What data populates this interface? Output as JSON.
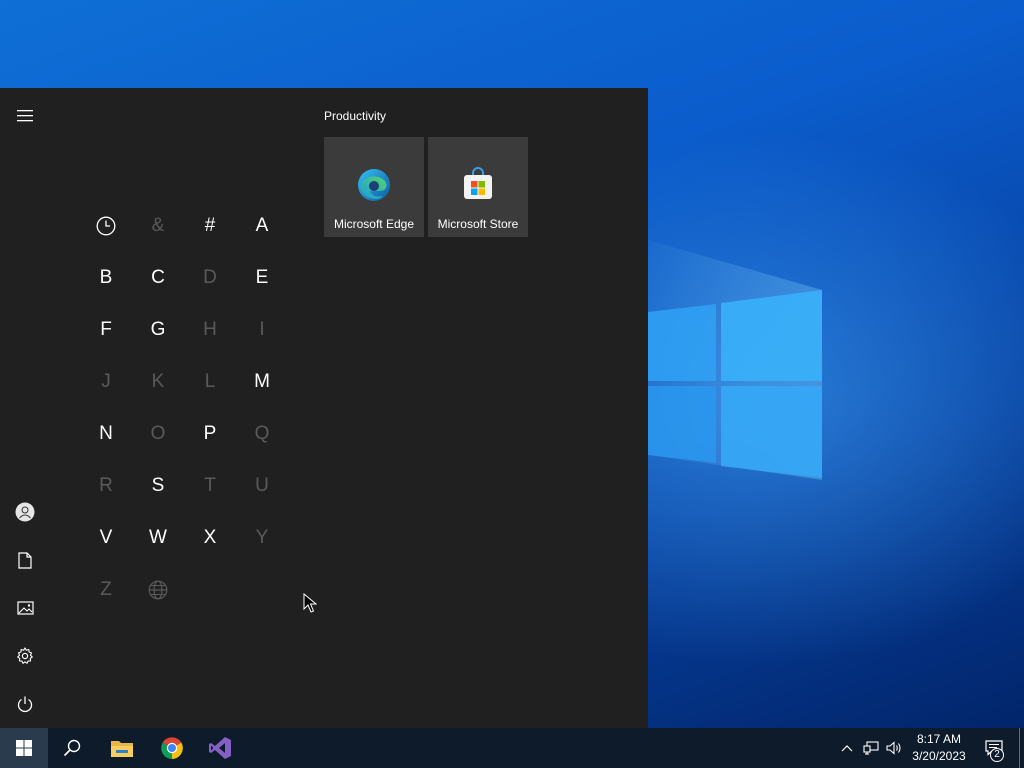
{
  "colors": {
    "start_menu_bg": "#202020",
    "tile_bg": "#3b3b3b",
    "taskbar_bg": "#0d1b2a",
    "disabled_letter": "#5a5a5a",
    "accent": "#0078d7"
  },
  "start_menu": {
    "rail": [
      {
        "name": "hamburger-menu",
        "icon": "hamburger-icon"
      },
      {
        "name": "user-account",
        "icon": "user-icon"
      },
      {
        "name": "documents",
        "icon": "document-icon"
      },
      {
        "name": "pictures",
        "icon": "pictures-icon"
      },
      {
        "name": "settings",
        "icon": "gear-icon"
      },
      {
        "name": "power",
        "icon": "power-icon"
      }
    ],
    "letters": [
      {
        "label": "",
        "icon": "clock-icon",
        "enabled": true
      },
      {
        "label": "&",
        "enabled": false
      },
      {
        "label": "#",
        "enabled": true
      },
      {
        "label": "A",
        "enabled": true
      },
      {
        "label": "B",
        "enabled": true
      },
      {
        "label": "C",
        "enabled": true
      },
      {
        "label": "D",
        "enabled": false
      },
      {
        "label": "E",
        "enabled": true
      },
      {
        "label": "F",
        "enabled": true
      },
      {
        "label": "G",
        "enabled": true
      },
      {
        "label": "H",
        "enabled": false
      },
      {
        "label": "I",
        "enabled": false
      },
      {
        "label": "J",
        "enabled": false
      },
      {
        "label": "K",
        "enabled": false
      },
      {
        "label": "L",
        "enabled": false
      },
      {
        "label": "M",
        "enabled": true
      },
      {
        "label": "N",
        "enabled": true
      },
      {
        "label": "O",
        "enabled": false
      },
      {
        "label": "P",
        "enabled": true
      },
      {
        "label": "Q",
        "enabled": false
      },
      {
        "label": "R",
        "enabled": false
      },
      {
        "label": "S",
        "enabled": true
      },
      {
        "label": "T",
        "enabled": false
      },
      {
        "label": "U",
        "enabled": false
      },
      {
        "label": "V",
        "enabled": true
      },
      {
        "label": "W",
        "enabled": true
      },
      {
        "label": "X",
        "enabled": true
      },
      {
        "label": "Y",
        "enabled": false
      },
      {
        "label": "Z",
        "enabled": false
      },
      {
        "label": "",
        "icon": "globe-icon",
        "enabled": false
      }
    ],
    "group_title": "Productivity",
    "tiles": [
      {
        "label": "Microsoft Edge",
        "icon": "edge-icon"
      },
      {
        "label": "Microsoft Store",
        "icon": "store-icon"
      }
    ]
  },
  "taskbar": {
    "apps": [
      {
        "name": "start",
        "icon": "windows-icon"
      },
      {
        "name": "search",
        "icon": "search-icon"
      },
      {
        "name": "file-explorer",
        "icon": "folder-icon"
      },
      {
        "name": "chrome",
        "icon": "chrome-icon"
      },
      {
        "name": "visual-studio",
        "icon": "visual-studio-icon"
      }
    ],
    "tray": {
      "icons": [
        "chevron-up-icon",
        "network-icon",
        "volume-icon"
      ],
      "time": "8:17 AM",
      "date": "3/20/2023",
      "notification_count": "2"
    }
  }
}
